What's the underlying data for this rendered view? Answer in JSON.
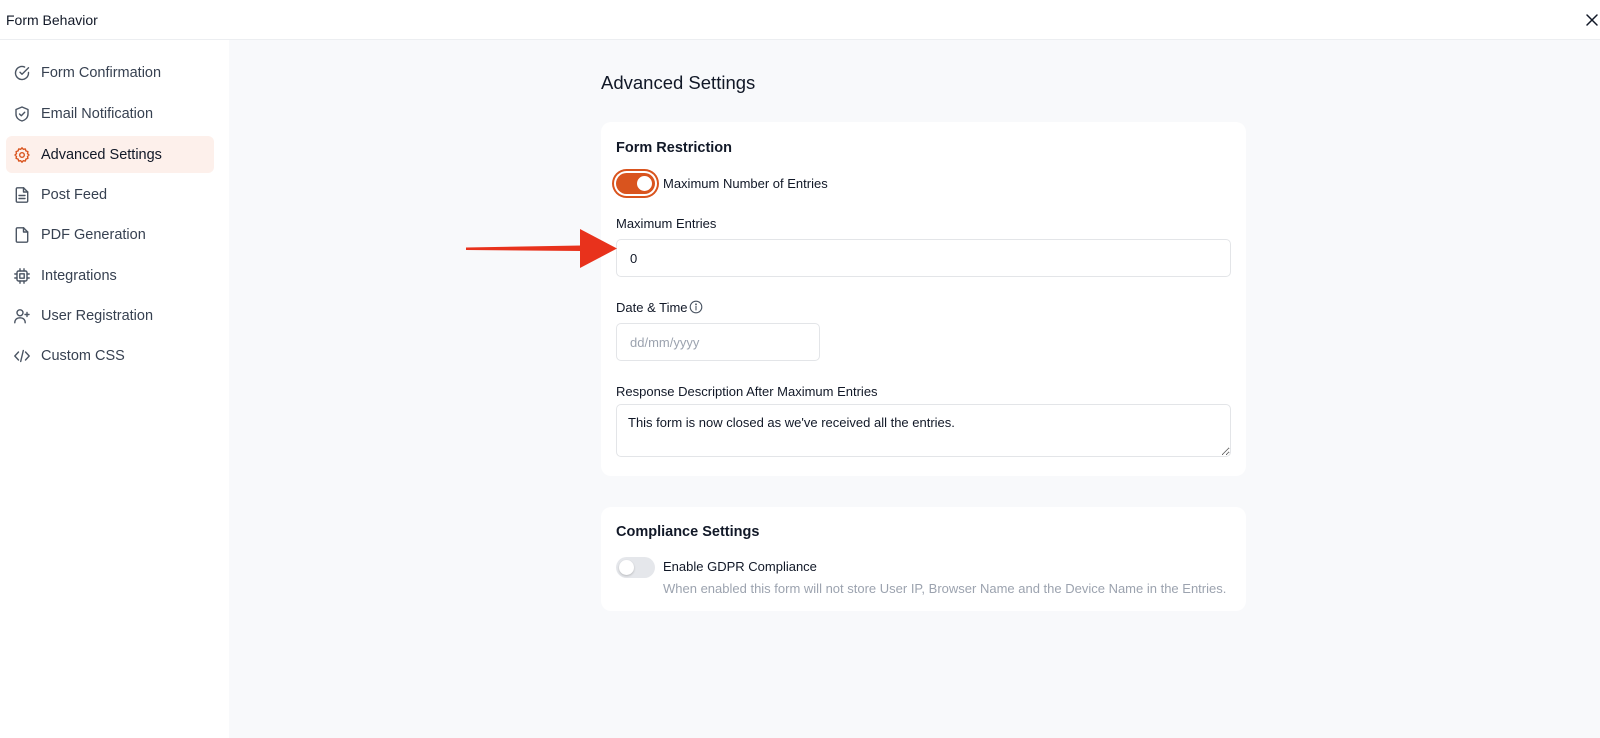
{
  "header": {
    "title": "Form Behavior",
    "close_icon": "close-icon"
  },
  "sidebar": {
    "items": [
      {
        "label": "Form Confirmation",
        "icon": "check-circle-icon",
        "active": false
      },
      {
        "label": "Email Notification",
        "icon": "shield-check-icon",
        "active": false
      },
      {
        "label": "Advanced Settings",
        "icon": "gear-icon",
        "active": true
      },
      {
        "label": "Post Feed",
        "icon": "file-text-icon",
        "active": false
      },
      {
        "label": "PDF Generation",
        "icon": "file-icon",
        "active": false
      },
      {
        "label": "Integrations",
        "icon": "chip-icon",
        "active": false
      },
      {
        "label": "User Registration",
        "icon": "user-plus-icon",
        "active": false
      },
      {
        "label": "Custom CSS",
        "icon": "code-icon",
        "active": false
      }
    ]
  },
  "main": {
    "title": "Advanced Settings",
    "form_restriction": {
      "title": "Form Restriction",
      "toggle_label": "Maximum Number of Entries",
      "toggle_on": true,
      "max_entries_label": "Maximum Entries",
      "max_entries_value": "0",
      "date_time_label": "Date & Time",
      "date_placeholder": "dd/mm/yyyy",
      "response_label": "Response Description After Maximum Entries",
      "response_value": "This form is now closed as we've received all the entries."
    },
    "compliance": {
      "title": "Compliance Settings",
      "toggle_label": "Enable GDPR Compliance",
      "toggle_on": false,
      "help_text": "When enabled this form will not store User IP, Browser Name and the Device Name in the Entries."
    }
  },
  "colors": {
    "accent": "#d9541e",
    "active_bg": "#fdf0eb",
    "annotation_arrow": "#e8321c"
  }
}
